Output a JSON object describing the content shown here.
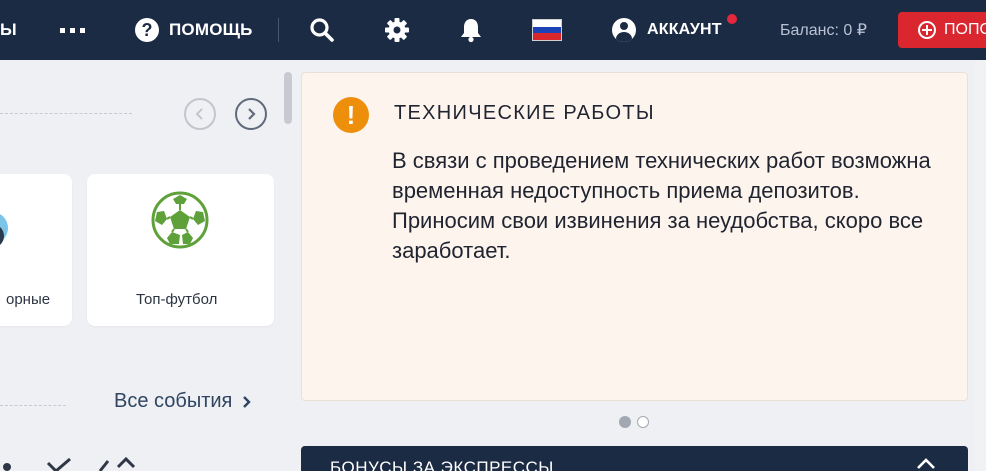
{
  "header": {
    "left_partial_label": "ы",
    "more_icon": "dots-icon",
    "help_label": "Помощь",
    "help_icon": "question-circle-icon",
    "search_icon": "search-icon",
    "settings_icon": "gear-icon",
    "notifications_icon": "bell-icon",
    "language_flag": "russian-flag-icon",
    "account_label": "Аккаунт",
    "balance_label": "Баланс: 0 ₽",
    "deposit_label": "Пополнить",
    "colors": {
      "bar": "#1c2b44",
      "deposit": "#d9262f",
      "badge": "#e3283b"
    }
  },
  "carousel": {
    "prev_icon": "chevron-left-icon",
    "next_icon": "chevron-right-icon",
    "cards": [
      {
        "label": "орные",
        "icon": "esports-icon"
      },
      {
        "label": "Топ-футбол",
        "icon": "football-icon"
      }
    ],
    "all_events_label": "Все события",
    "all_events_icon": "chevron-right-icon"
  },
  "notice": {
    "icon": "exclamation-icon",
    "title": "ТЕХНИЧЕСКИЕ РАБОТЫ",
    "body": "В связи с проведением технических работ возможна временная недоступность приема депозитов. Приносим свои извинения за неудобства, скоро все заработает.",
    "colors": {
      "background": "#fdf4ee",
      "icon": "#ee8f0c"
    }
  },
  "pagination": {
    "total": 2,
    "active": 1
  },
  "bonus": {
    "title": "Бонусы за экспрессы",
    "toggle_icon": "chevron-up-icon"
  }
}
